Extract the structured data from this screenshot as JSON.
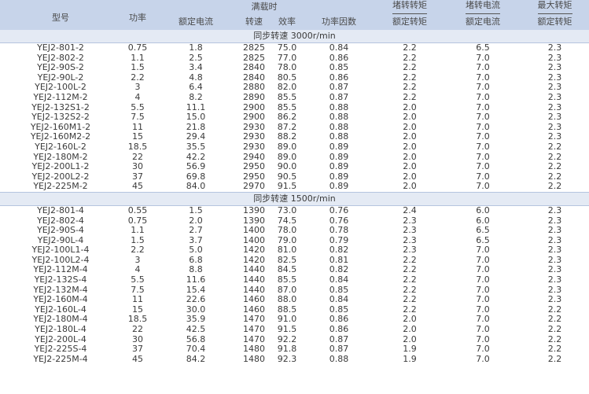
{
  "header": {
    "model": "型号",
    "power": "功率",
    "full_load": "满载时",
    "rated_current": "额定电流",
    "speed": "转速",
    "efficiency": "效率",
    "power_factor": "功率因数",
    "locked_torque_top": "堵转转矩",
    "locked_torque_bottom": "额定转矩",
    "locked_current_top": "堵转电流",
    "locked_current_bottom": "额定电流",
    "max_torque_top": "最大转矩",
    "max_torque_bottom": "额定转矩"
  },
  "sections": [
    {
      "title": "同步转速 3000r/min",
      "rows": [
        [
          "YEJ2-801-2",
          "0.75",
          "1.8",
          "2825",
          "75.0",
          "0.84",
          "2.2",
          "6.5",
          "2.3"
        ],
        [
          "YEJ2-802-2",
          "1.1",
          "2.5",
          "2825",
          "77.0",
          "0.86",
          "2.2",
          "7.0",
          "2.3"
        ],
        [
          "YEJ2-90S-2",
          "1.5",
          "3.4",
          "2840",
          "78.0",
          "0.85",
          "2.2",
          "7.0",
          "2.3"
        ],
        [
          "YEJ2-90L-2",
          "2.2",
          "4.8",
          "2840",
          "80.5",
          "0.86",
          "2.2",
          "7.0",
          "2.3"
        ],
        [
          "YEJ2-100L-2",
          "3",
          "6.4",
          "2880",
          "82.0",
          "0.87",
          "2.2",
          "7.0",
          "2.3"
        ],
        [
          "YEJ2-112M-2",
          "4",
          "8.2",
          "2890",
          "85.5",
          "0.87",
          "2.2",
          "7.0",
          "2.3"
        ],
        [
          "YEJ2-132S1-2",
          "5.5",
          "11.1",
          "2900",
          "85.5",
          "0.88",
          "2.0",
          "7.0",
          "2.3"
        ],
        [
          "YEJ2-132S2-2",
          "7.5",
          "15.0",
          "2900",
          "86.2",
          "0.88",
          "2.0",
          "7.0",
          "2.3"
        ],
        [
          "YEJ2-160M1-2",
          "11",
          "21.8",
          "2930",
          "87.2",
          "0.88",
          "2.0",
          "7.0",
          "2.3"
        ],
        [
          "YEJ2-160M2-2",
          "15",
          "29.4",
          "2930",
          "88.2",
          "0.88",
          "2.0",
          "7.0",
          "2.3"
        ],
        [
          "YEJ2-160L-2",
          "18.5",
          "35.5",
          "2930",
          "89.0",
          "0.89",
          "2.0",
          "7.0",
          "2.2"
        ],
        [
          "YEJ2-180M-2",
          "22",
          "42.2",
          "2940",
          "89.0",
          "0.89",
          "2.0",
          "7.0",
          "2.2"
        ],
        [
          "YEJ2-200L1-2",
          "30",
          "56.9",
          "2950",
          "90.0",
          "0.89",
          "2.0",
          "7.0",
          "2.2"
        ],
        [
          "YEJ2-200L2-2",
          "37",
          "69.8",
          "2950",
          "90.5",
          "0.89",
          "2.0",
          "7.0",
          "2.2"
        ],
        [
          "YEJ2-225M-2",
          "45",
          "84.0",
          "2970",
          "91.5",
          "0.89",
          "2.0",
          "7.0",
          "2.2"
        ]
      ]
    },
    {
      "title": "同步转速 1500r/min",
      "rows": [
        [
          "YEJ2-801-4",
          "0.55",
          "1.5",
          "1390",
          "73.0",
          "0.76",
          "2.4",
          "6.0",
          "2.3"
        ],
        [
          "YEJ2-802-4",
          "0.75",
          "2.0",
          "1390",
          "74.5",
          "0.76",
          "2.3",
          "6.0",
          "2.3"
        ],
        [
          "YEJ2-90S-4",
          "1.1",
          "2.7",
          "1400",
          "78.0",
          "0.78",
          "2.3",
          "6.5",
          "2.3"
        ],
        [
          "YEJ2-90L-4",
          "1.5",
          "3.7",
          "1400",
          "79.0",
          "0.79",
          "2.3",
          "6.5",
          "2.3"
        ],
        [
          "YEJ2-100L1-4",
          "2.2",
          "5.0",
          "1420",
          "81.0",
          "0.82",
          "2.3",
          "7.0",
          "2.3"
        ],
        [
          "YEJ2-100L2-4",
          "3",
          "6.8",
          "1420",
          "82.5",
          "0.81",
          "2.2",
          "7.0",
          "2.3"
        ],
        [
          "YEJ2-112M-4",
          "4",
          "8.8",
          "1440",
          "84.5",
          "0.82",
          "2.2",
          "7.0",
          "2.3"
        ],
        [
          "YEJ2-132S-4",
          "5.5",
          "11.6",
          "1440",
          "85.5",
          "0.84",
          "2.2",
          "7.0",
          "2.3"
        ],
        [
          "YEJ2-132M-4",
          "7.5",
          "15.4",
          "1440",
          "87.0",
          "0.85",
          "2.2",
          "7.0",
          "2.3"
        ],
        [
          "YEJ2-160M-4",
          "11",
          "22.6",
          "1460",
          "88.0",
          "0.84",
          "2.2",
          "7.0",
          "2.3"
        ],
        [
          "YEJ2-160L-4",
          "15",
          "30.0",
          "1460",
          "88.5",
          "0.85",
          "2.2",
          "7.0",
          "2.2"
        ],
        [
          "YEJ2-180M-4",
          "18.5",
          "35.9",
          "1470",
          "91.0",
          "0.86",
          "2.0",
          "7.0",
          "2.2"
        ],
        [
          "YEJ2-180L-4",
          "22",
          "42.5",
          "1470",
          "91.5",
          "0.86",
          "2.0",
          "7.0",
          "2.2"
        ],
        [
          "YEJ2-200L-4",
          "30",
          "56.8",
          "1470",
          "92.2",
          "0.87",
          "2.0",
          "7.0",
          "2.2"
        ],
        [
          "YEJ2-225S-4",
          "37",
          "70.4",
          "1480",
          "91.8",
          "0.87",
          "1.9",
          "7.0",
          "2.2"
        ],
        [
          "YEJ2-225M-4",
          "45",
          "84.2",
          "1480",
          "92.3",
          "0.88",
          "1.9",
          "7.0",
          "2.2"
        ]
      ]
    }
  ],
  "colors": {
    "header_bg": "#c7d4ea",
    "section_bg": "#e4eaf4",
    "text": "#3a3a3a"
  }
}
